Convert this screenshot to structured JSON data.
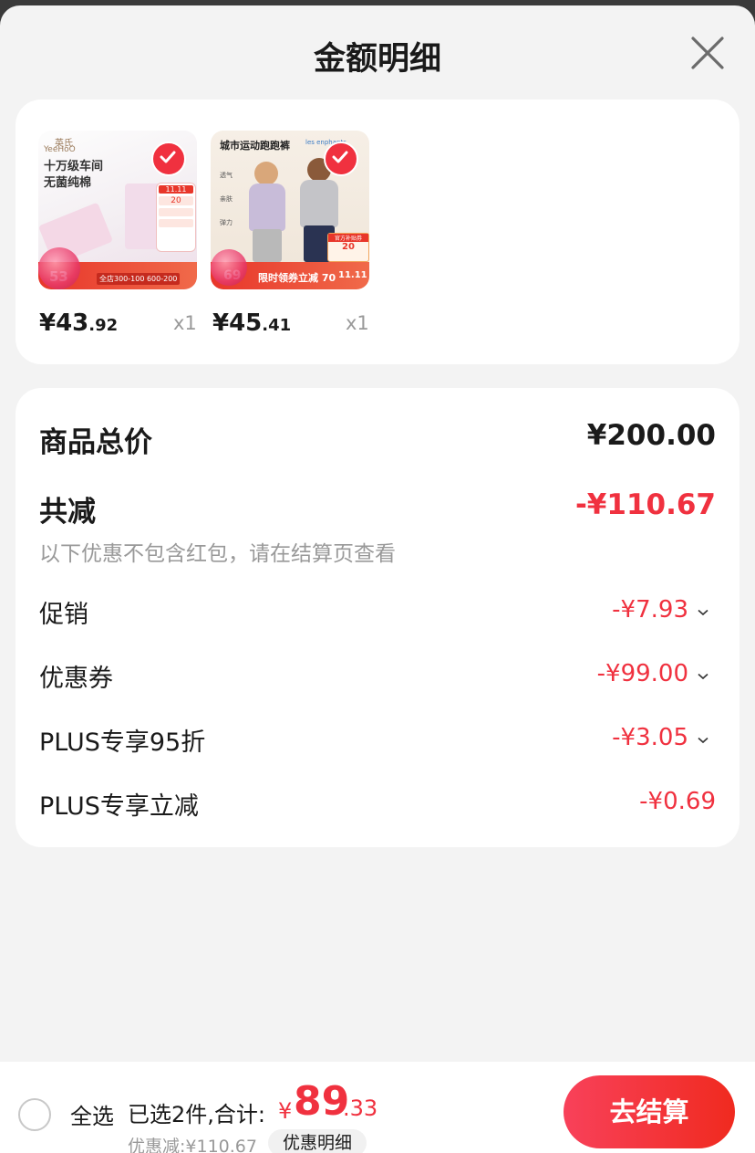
{
  "sheet": {
    "title": "金额明细"
  },
  "products": [
    {
      "price_int": "¥43",
      "price_dec": ".92",
      "qty": "x1",
      "image": {
        "brand": "英氏",
        "brand_en": "YeeHoO",
        "headline1": "十万级车间",
        "headline2": "无菌纯棉",
        "coupon_amount": "20",
        "promo_strip": "全店300-100 600-200",
        "price_tag": "53",
        "event": "11.11"
      }
    },
    {
      "price_int": "¥45",
      "price_dec": ".41",
      "qty": "x1",
      "image": {
        "headline": "城市运动跑跑裤",
        "brand": "les enphants",
        "features": [
          "透气",
          "亲肤",
          "弹力"
        ],
        "badge": "官方补贴券",
        "coupon_amount": "20",
        "promo_strip": "限时领券立减 70",
        "price_tag": "69",
        "event": "11.11"
      }
    }
  ],
  "summary": {
    "total_label": "商品总价",
    "total_value": "¥200.00",
    "reduce_label": "共减",
    "reduce_value": "-¥110.67",
    "note": "以下优惠不包含红包，请在结算页查看",
    "rows": [
      {
        "label": "促销",
        "value": "-¥7.93"
      },
      {
        "label": "优惠券",
        "value": "-¥99.00"
      },
      {
        "label": "PLUS专享95折",
        "value": "-¥3.05"
      },
      {
        "label": "PLUS专享立减",
        "value": "-¥0.69"
      }
    ]
  },
  "footer": {
    "select_all": "全选",
    "selected_text": "已选2件,合计:",
    "currency": "¥",
    "total_int": "89",
    "total_dec": ".33",
    "discount_text": "优惠减:¥110.67",
    "detail_button": "优惠明细",
    "checkout_button": "去结算"
  },
  "colors": {
    "accent": "#f0313f",
    "checkout_from": "#f8415a",
    "checkout_to": "#f02a1f"
  }
}
